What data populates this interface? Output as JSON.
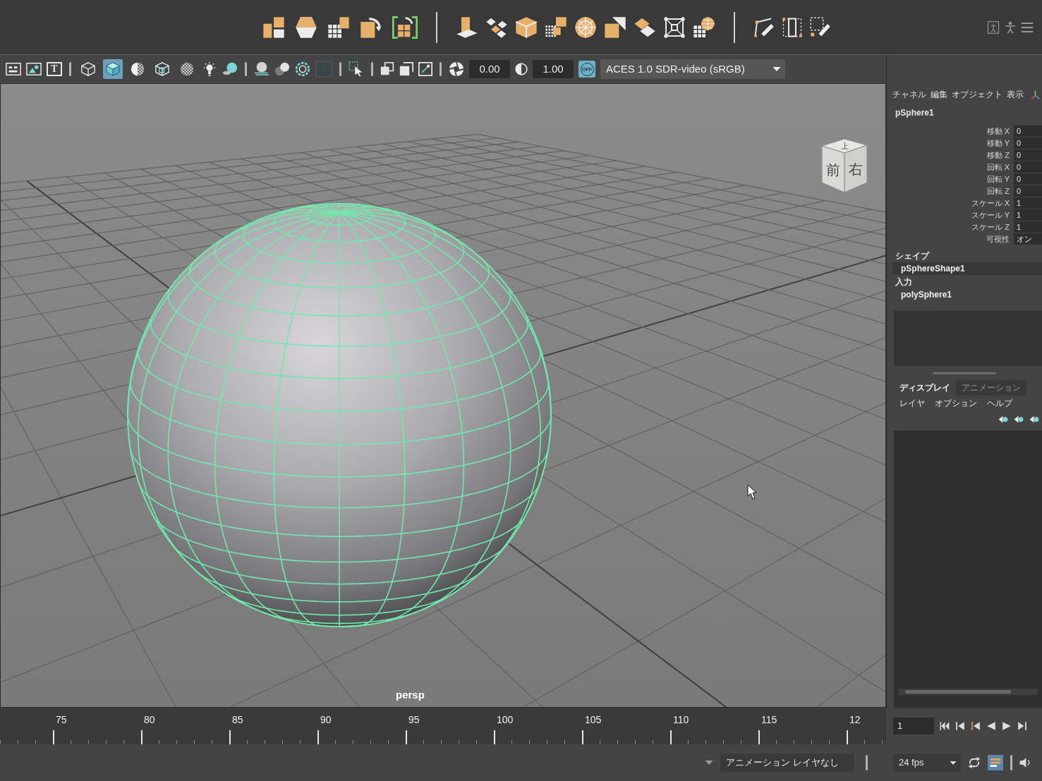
{
  "viewport_toolbar": {
    "type_glyph": "T",
    "shading_buttons": [
      {
        "selected": false
      },
      {
        "selected": true
      },
      {
        "selected": false
      },
      {
        "selected": false
      },
      {
        "selected": false
      }
    ],
    "exposure": "0.00",
    "gamma": "1.00",
    "color_management": {
      "badge": "OFF",
      "view_transform": "ACES 1.0 SDR-video (sRGB)"
    }
  },
  "viewport": {
    "view_cube": {
      "top": "上",
      "front": "前",
      "right": "右"
    },
    "camera": "persp"
  },
  "channel_box": {
    "menus": [
      "チャネル",
      "編集",
      "オブジェクト",
      "表示"
    ],
    "object": "pSphere1",
    "channels": [
      {
        "name": "移動 X",
        "value": "0"
      },
      {
        "name": "移動 Y",
        "value": "0"
      },
      {
        "name": "移動 Z",
        "value": "0"
      },
      {
        "name": "回転 X",
        "value": "0"
      },
      {
        "name": "回転 Y",
        "value": "0"
      },
      {
        "name": "回転 Z",
        "value": "0"
      },
      {
        "name": "スケール X",
        "value": "1"
      },
      {
        "name": "スケール Y",
        "value": "1"
      },
      {
        "name": "スケール Z",
        "value": "1"
      },
      {
        "name": "可視性",
        "value": "オン"
      }
    ],
    "shapes_heading": "シェイプ",
    "shape": "pSphereShape1",
    "inputs_heading": "入力",
    "input": "polySphere1"
  },
  "layer_editor": {
    "tabs": [
      {
        "label": "ディスプレイ",
        "selected": true
      },
      {
        "label": "アニメーション",
        "selected": false
      }
    ],
    "menus": [
      "レイヤ",
      "オプション",
      "ヘルプ"
    ]
  },
  "time_slider": {
    "frame_labels": [
      "75",
      "80",
      "85",
      "90",
      "95",
      "100",
      "105",
      "110",
      "115",
      "12"
    ],
    "current_frame": "1"
  },
  "playback": {
    "animation_layer": "アニメーション レイヤなし",
    "fps": "24 fps"
  }
}
